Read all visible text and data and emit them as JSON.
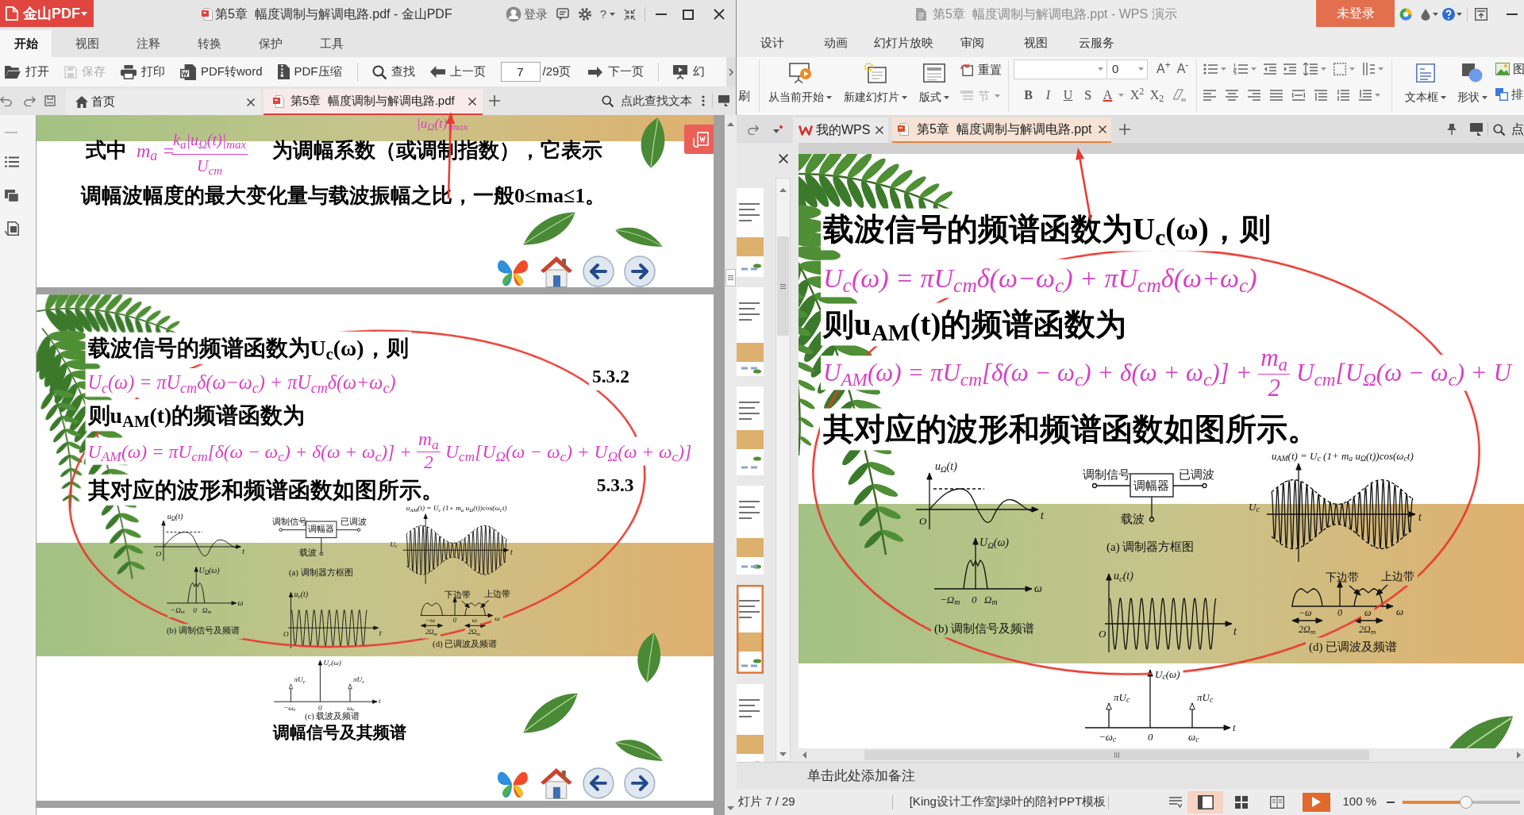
{
  "pdf_window": {
    "app_button": "金山PDF",
    "title": "第5章  幅度调制与解调电路.pdf - 金山PDF",
    "login": "登录",
    "help": "?",
    "menu_tabs": [
      {
        "label": "开始",
        "selected": true
      },
      {
        "label": "视图",
        "selected": false
      },
      {
        "label": "注释",
        "selected": false
      },
      {
        "label": "转换",
        "selected": false
      },
      {
        "label": "保护",
        "selected": false
      },
      {
        "label": "工具",
        "selected": false
      }
    ],
    "toolbar": [
      {
        "label": "打开",
        "disabled": false
      },
      {
        "label": "保存",
        "disabled": true
      },
      {
        "label": "打印",
        "disabled": false
      },
      {
        "label": "PDF转word",
        "disabled": false
      },
      {
        "label": "PDF压缩",
        "disabled": false
      },
      {
        "label": "查找",
        "disabled": false
      },
      {
        "label": "上一页",
        "disabled": false
      }
    ],
    "page_number": {
      "value": "7",
      "total": "/29页"
    },
    "toolbar_after": [
      {
        "label": "下一页",
        "disabled": false
      },
      {
        "label": "幻",
        "disabled": false
      }
    ],
    "doc_tabs": [
      {
        "label": "首页",
        "selected": false
      },
      {
        "label": "第5章  幅度调制与解调电路.pdf",
        "selected": true
      }
    ],
    "find_text": "点此查找文本",
    "page_above": {
      "formula_fragment": "|u$_{Ω}$(t)|$_{max}$",
      "lead": "式中",
      "formula_lhs": "m$_{a}$ =",
      "numerator": "k$_{a}$|u$_{Ω}$(t)|$_{max}$",
      "denominator": "U$_{cm}$",
      "line_end": "为调幅系数（或调制指数），它表示",
      "line_2": "调幅波幅度的最大变化量与载波振幅之比，一般0≤ma≤1。"
    },
    "slide": {
      "line_1": "载波信号的频谱函数为U$_{c}$(ω)，则",
      "formula_1": "U$_{c}$(ω) = πU$_{cm}$δ(ω−ω$_{c}$) + πU$_{cm}$δ(ω+ω$_{c}$)",
      "equation_number_1": "5.3.2",
      "line_2": "则u$_{AM}$(t)的频谱函数为",
      "formula_2": {
        "before": "U$_{AM}$(ω) = πU$_{cm}$[δ(ω − ω$_{c}$) + δ(ω + ω$_{c}$)] +",
        "numerator": "m$_{a}$",
        "denominator": "2",
        "after": "U$_{cm}$[U$_{Ω}$(ω − ω$_{c}$) + U$_{Ω}$(ω + ω$_{c}$)]"
      },
      "line_3": "其对应的波形和频谱函数如图所示。",
      "equation_number_2": "5.3.3",
      "figure": {
        "modulating_signal": {
          "y_label": "u$_{Ω}$(t)",
          "x_label": "t",
          "origin": "O"
        },
        "modulating_spectrum": {
          "y_label": "U$_{Ω}$(ω)",
          "ticks": [
            "−Ω$_{m}$",
            "0",
            "Ω$_{m}$"
          ],
          "x_label": "ω"
        },
        "caption_b": "(b) 调制信号及频谱",
        "block_diagram": {
          "input": "调制信号",
          "block": "调幅器",
          "output": "已调波",
          "carrier": "载波"
        },
        "caption_a": "(a) 调制器方框图",
        "carrier_signal": {
          "y_label": "u$_{c}$(t)",
          "origin": "O",
          "x_label": "t"
        },
        "am_signal": {
          "formula": "u$_{AM}$(t) = U$_{c}$ (1+ m$_{a}$ u$_{Ω}$(t))cos(ω$_{c}$t)",
          "amplitude": "U$_{c}$",
          "x_label": "t"
        },
        "am_spectrum": {
          "lower_band": "下边带",
          "upper_band": "上边带",
          "ticks": [
            "−ω",
            "0",
            "ω"
          ],
          "x_label": "ω",
          "bandwidths": [
            "2Ω$_{m}$",
            "2Ω$_{m}$"
          ]
        },
        "caption_d": "(d) 已调波及频谱",
        "carrier_spectrum": {
          "y_label": "U$_{c}$(ω)",
          "peak_labels": [
            "πU$_{c}$",
            "πU$_{c}$"
          ],
          "ticks": [
            "−ω$_{c}$",
            "0",
            "ω$_{c}$"
          ],
          "x_label": "t"
        },
        "caption_c": "(c) 载波及频谱"
      },
      "figure_title": "调幅信号及其频谱"
    }
  },
  "wps_window": {
    "title": "第5章  幅度调制与解调电路.ppt - WPS 演示",
    "login_button": "未登录",
    "menu_tabs": [
      {
        "label": "设计",
        "selected": false
      },
      {
        "label": "动画",
        "selected": false
      },
      {
        "label": "幻灯片放映",
        "selected": false
      },
      {
        "label": "审阅",
        "selected": false
      },
      {
        "label": "视图",
        "selected": false
      },
      {
        "label": "云服务",
        "selected": false
      }
    ],
    "ribbon": {
      "format_painter": "刷",
      "large_buttons": [
        {
          "label": "从当前开始"
        },
        {
          "label": "新建幻灯片"
        },
        {
          "label": "版式"
        }
      ],
      "reset": "重置",
      "section": {
        "label": "节",
        "disabled": true
      },
      "font_size": "0",
      "font_buttons": [
        "A$^{+}$",
        "A$^{-}$"
      ],
      "format_buttons": [
        "B",
        "I",
        "U",
        "S",
        "A",
        "X$^{2}$",
        "X$_{2}$"
      ],
      "insert_buttons": [
        {
          "label": "文本框"
        },
        {
          "label": "形状"
        }
      ],
      "picture": "图",
      "arrange": "排"
    },
    "doc_tabs": [
      {
        "label": "我的WPS",
        "selected": false
      },
      {
        "label": "第5章  幅度调制与解调电路.ppt",
        "selected": true
      }
    ],
    "search_partial": "点",
    "thumbnails": [
      {
        "selected": false
      },
      {
        "selected": false
      },
      {
        "selected": false
      },
      {
        "selected": false
      },
      {
        "selected": true
      },
      {
        "selected": false
      }
    ],
    "slide": {
      "line_1": "载波信号的频谱函数为U$_{c}$(ω)，则",
      "formula_1": "U$_{c}$(ω) = πU$_{cm}$δ(ω−ω$_{c}$) + πU$_{cm}$δ(ω+ω$_{c}$)",
      "line_2": "则u$_{AM}$(t)的频谱函数为",
      "formula_2": {
        "before": "U$_{AM}$(ω) = πU$_{cm}$[δ(ω − ω$_{c}$) + δ(ω + ω$_{c}$)] +",
        "numerator": "m$_{a}$",
        "denominator": "2",
        "after": "U$_{cm}$[U$_{Ω}$(ω − ω$_{c}$) + U"
      },
      "line_3": "其对应的波形和频谱函数如图所示。",
      "figure": {
        "modulating_signal": {
          "y_label": "u$_{Ω}$(t)",
          "x_label": "t",
          "origin": "O"
        },
        "modulating_spectrum": {
          "y_label": "U$_{Ω}$(ω)",
          "ticks": [
            "−Ω$_{m}$",
            "0",
            "Ω$_{m}$"
          ],
          "x_label": "ω"
        },
        "caption_b": "(b) 调制信号及频谱",
        "block_diagram": {
          "input": "调制信号",
          "block": "调幅器",
          "output": "已调波",
          "carrier": "载波"
        },
        "caption_a": "(a) 调制器方框图",
        "carrier_signal": {
          "y_label": "u$_{c}$(t)",
          "origin": "O",
          "x_label": "t"
        },
        "am_signal": {
          "formula": "u$_{AM}$(t) = U$_{c}$ (1+ m$_{a}$ u$_{Ω}$(t))cos(ω$_{c}$t)",
          "amplitude": "U$_{c}$",
          "x_label": "t"
        },
        "am_spectrum": {
          "lower_band": "下边带",
          "upper_band": "上边带",
          "ticks": [
            "−ω",
            "0",
            "ω"
          ],
          "x_label": "ω",
          "bandwidths": [
            "2Ω$_{m}$",
            "2Ω$_{m}$"
          ]
        },
        "caption_d": "(d) 已调波及频谱",
        "carrier_spectrum": {
          "y_label": "U$_{c}$(ω)",
          "peak_labels": [
            "πU$_{c}$",
            "πU$_{c}$"
          ],
          "ticks": [
            "−ω$_{c}$",
            "0",
            "ω$_{c}$"
          ],
          "x_label": "t"
        }
      }
    },
    "notes_placeholder": "单击此处添加备注",
    "status_bar": {
      "slide_counter": "灯片 7 / 29",
      "template": "[King设计工作室]绿叶的陪衬PPT模板",
      "views": [
        {
          "selected": true
        },
        {
          "selected": false
        },
        {
          "selected": false
        }
      ],
      "zoom": "100 %",
      "zoom_slider": {
        "level": 0.54
      }
    }
  }
}
